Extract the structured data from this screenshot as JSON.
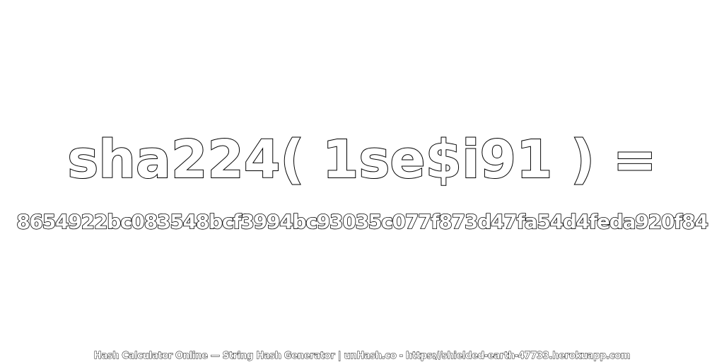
{
  "expression": "sha224( 1se$i91 ) =",
  "hash": "8654922bc083548bcf3994bc93035c077f873d47fa54d4feda920f84",
  "footer": "Hash Calculator Online — String Hash Generator | unHash.co - https://shielded-earth-47733.herokuapp.com",
  "colors": {
    "background": "#ffffff",
    "text_fill": "#ffffff",
    "text_outline": "#000000"
  }
}
